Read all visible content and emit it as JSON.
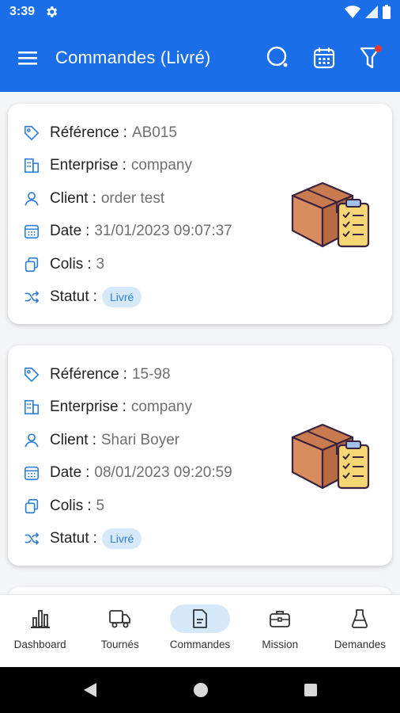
{
  "status_bar": {
    "time": "3:39"
  },
  "app_bar": {
    "title": "Commandes (Livré)"
  },
  "cards": [
    {
      "reference_label": "Référence",
      "reference": "AB015",
      "enterprise_label": "Enterprise",
      "enterprise": "company",
      "client_label": "Client",
      "client": "order test",
      "date_label": "Date",
      "date": "31/01/2023 09:07:37",
      "colis_label": "Colis",
      "colis": "3",
      "statut_label": "Statut",
      "statut": "Livré"
    },
    {
      "reference_label": "Référence",
      "reference": "15-98",
      "enterprise_label": "Enterprise",
      "enterprise": "company",
      "client_label": "Client",
      "client": "Shari Boyer",
      "date_label": "Date",
      "date": "08/01/2023 09:20:59",
      "colis_label": "Colis",
      "colis": "5",
      "statut_label": "Statut",
      "statut": "Livré"
    }
  ],
  "bottom_nav": [
    {
      "label": "Dashboard",
      "icon": "bar-chart-icon"
    },
    {
      "label": "Tournés",
      "icon": "truck-icon"
    },
    {
      "label": "Commandes",
      "icon": "document-icon",
      "active": true
    },
    {
      "label": "Mission",
      "icon": "briefcase-icon"
    },
    {
      "label": "Demandes",
      "icon": "flask-icon"
    }
  ],
  "colors": {
    "primary": "#1a6ee8",
    "badge_bg": "#d6e9fb",
    "badge_text": "#2d7fd8",
    "icon_blue": "#2d7fd8",
    "alert": "#e53935"
  }
}
